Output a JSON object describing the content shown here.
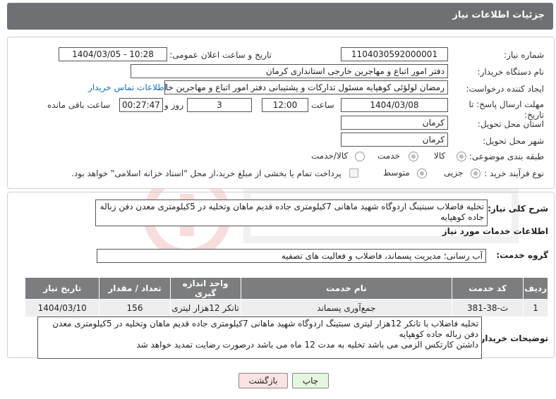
{
  "header": {
    "title": "جزئیات اطلاعات نیاز"
  },
  "fields": {
    "need_number_label": "شماره نیاز:",
    "need_number": "1104030592000001",
    "announce_label": "تاریخ و ساعت اعلان عمومی:",
    "announce_value": "1404/03/05 - 10:28",
    "buyer_label": "نام دستگاه خریدار:",
    "buyer_value": "دفتر  امور اتباع و مهاجرین خارجی استانداری کرمان",
    "creator_label": "ایجاد کننده درخواست:",
    "creator_value": "رمضان لولؤئی کوهپایه مسئول تدارکات و پشتیبانی دفتر  امور اتباع و مهاجرین خارجی",
    "contact_link": "اطلاعات تماس خریدار",
    "deadline_label": "مهلت ارسال پاسخ: تا تاریخ:",
    "deadline_date": "1404/03/08",
    "time_label": "ساعت",
    "deadline_time": "12:00",
    "days_value": "3",
    "days_label": "روز و",
    "remaining_time": "00:27:47",
    "remaining_label": "ساعت باقی مانده",
    "province_label": "استان محل تحویل:",
    "province_value": "کرمان",
    "city_label": "شهر محل تحویل:",
    "city_value": "کرمان",
    "category_label": "طبقه بندی موضوعی:",
    "category_options": [
      "کالا",
      "خدمت",
      "کالا/خدمت"
    ],
    "process_label": "نوع فرآیند خرید :",
    "process_options": [
      "جزیی",
      "متوسط"
    ],
    "payment_note": "پرداخت تمام یا بخشی از مبلغ خرید،از محل \"اسناد خزانه اسلامی\" خواهد بود."
  },
  "summary": {
    "label": "شرح کلی نیاز:",
    "text": "تخلیه فاضلاب  سبتینگ اردوگاه شهید ماهانی 7کیلومتری جاده قدیم ماهان وتخلیه در 5کیلومتری معدن دفن زباله  جاده کوهپایه"
  },
  "services": {
    "section_title": "اطلاعات خدمات مورد نیاز",
    "group_label": "گروه خدمت:",
    "group_value": "آب رسانی؛ مدیریت پسماند، فاضلاب و فعالیت های تصفیه",
    "columns": [
      "ردیف",
      "کد خدمت",
      "نام خدمت",
      "واحد اندازه گیری",
      "تعداد / مقدار",
      "تاریخ نیاز"
    ],
    "rows": [
      [
        "1",
        "ث-38-381",
        "جمع‌آوری پسماند",
        "تانکر 12هزار لیتری",
        "156",
        "1404/03/10"
      ]
    ]
  },
  "buyer_notes": {
    "label": "توضیحات خریدار:",
    "line1": "تخلیه فاضلاب   با تانکر 12هزار لیتری سبتینگ اردوگاه شهید ماهانی 7کیلومتری جاده قدیم ماهان وتخلیه در 5کیلومتری معدن دفن زباله  جاده کوهپایه",
    "line2": "داشتن کارتکس  الزمی می باشد   تخلیه به مدت 12 ماه می باشد درصورت رضایت تمدید خواهد شد"
  },
  "buttons": {
    "print": "چاپ",
    "back": "بازگشت"
  },
  "colors": {
    "header_bg": "#6d7173",
    "table_header_bg": "#7a7e80",
    "link": "#1a6fc2",
    "print_btn": "#e6f7df",
    "back_btn": "#fbe3e3"
  }
}
